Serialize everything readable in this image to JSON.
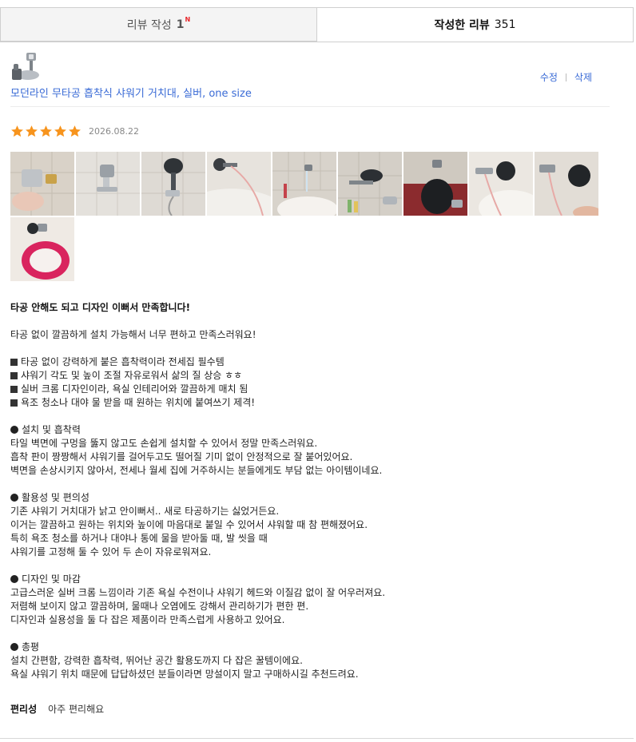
{
  "tabs": [
    {
      "label": "리뷰 작성",
      "count": "1",
      "badge": "N"
    },
    {
      "label": "작성한 리뷰",
      "count": "351"
    }
  ],
  "product": {
    "name": "모던라인 무타공 흡착식 샤워기 거치대, 실버, one size",
    "thumbnail_icon": "shower-holder-thumbnail"
  },
  "actions": {
    "edit": "수정",
    "delete": "삭제"
  },
  "review": {
    "rating": 5,
    "date": "2026.08.22",
    "photo_count": 10,
    "headline": "타공 안해도 되고 디자인 이뻐서 만족합니다!",
    "intro": "타공 없이 깔끔하게 설치 가능해서 너무 편하고 만족스러워요!",
    "highlights": [
      "타공 없이 강력하게 붙은 흡착력이라 전세집 필수템",
      "샤워기 각도 및 높이 조절 자유로워서 삶의 질 상승 ㅎㅎ",
      "실버 크롬 디자인이라, 욕실 인테리어와 깔끔하게 매치 됨",
      "욕조 청소나 대야 물 받을 때 원하는 위치에 붙여쓰기 제격!"
    ],
    "sections": [
      {
        "title": "설치 및 흡착력",
        "lines": [
          "타일 벽면에 구멍을 뚫지 않고도 손쉽게 설치할 수 있어서 정말 만족스러워요.",
          "흡착 판이 짱짱해서 샤워기를 걸어두고도 떨어질 기미 없이 안정적으로 잘 붙어있어요.",
          "벽면을 손상시키지 않아서, 전세나 월세 집에 거주하시는 분들에게도 부담 없는 아이템이네요."
        ]
      },
      {
        "title": "활용성 및 편의성",
        "lines": [
          "기존 샤워기 거치대가 낡고 안이뻐서.. 새로 타공하기는 싫었거든요.",
          "이거는 깔끔하고 원하는 위치와 높이에 마음대로 붙일 수 있어서 샤워할 때 참 편해졌어요.",
          "특히 욕조 청소를 하거나 대야나 통에 물을 받아둘 때, 발 씻을 때",
          "샤워기를 고정해 둘 수 있어 두 손이 자유로워져요."
        ]
      },
      {
        "title": "디자인 및 마감",
        "lines": [
          "고급스러운 실버 크롬 느낌이라 기존 욕실 수전이나 샤워기 헤드와 이질감 없이 잘 어우러져요.",
          "저렴해 보이지 않고 깔끔하며, 물때나 오염에도 강해서 관리하기가 편한 편.",
          "디자인과 실용성을 둘 다 잡은 제품이라 만족스럽게 사용하고 있어요."
        ]
      },
      {
        "title": "총평",
        "lines": [
          "설치 간편함, 강력한 흡착력, 뛰어난 공간 활용도까지 다 잡은 꿀템이에요.",
          "욕실 샤워기 위치 때문에 답답하셨던 분들이라면 망설이지 말고 구매하시길 추천드려요."
        ]
      }
    ],
    "survey": {
      "question": "편리성",
      "answer": "아주 편리해요"
    }
  },
  "colors": {
    "star": "#f7941d",
    "link": "#3a6bd6",
    "badge": "#e8262a"
  }
}
